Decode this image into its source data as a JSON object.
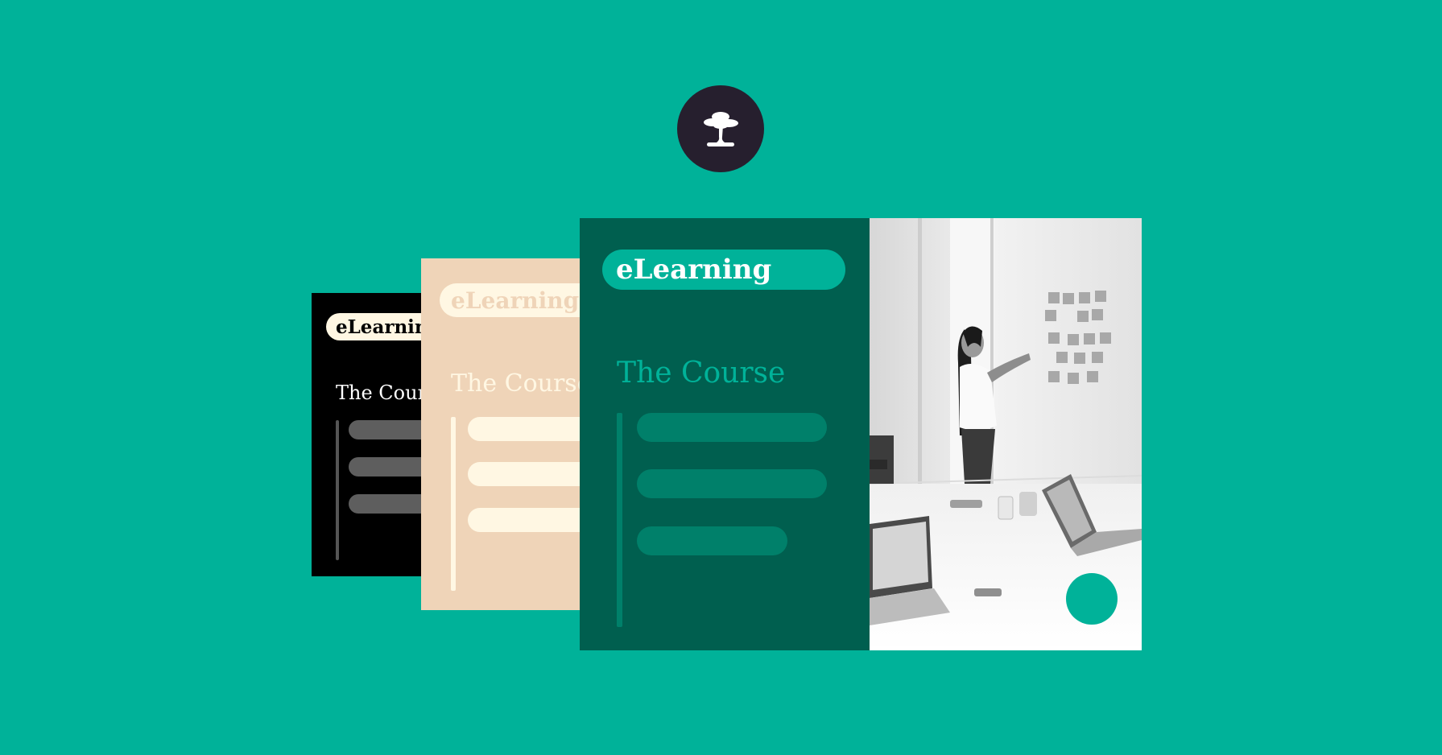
{
  "brand": {
    "logo_icon": "bonsai-tree-icon",
    "background_color": "#00b299",
    "logo_circle_color": "#261f2e"
  },
  "cards": {
    "black": {
      "pill_label": "eLearning",
      "heading": "The Course"
    },
    "beige": {
      "pill_label": "eLearning",
      "heading": "The Course"
    },
    "green": {
      "pill_label": "eLearning",
      "heading": "The Course"
    }
  },
  "photo": {
    "icon": "classroom-photo-icon",
    "accent_dot_color": "#00b299"
  }
}
